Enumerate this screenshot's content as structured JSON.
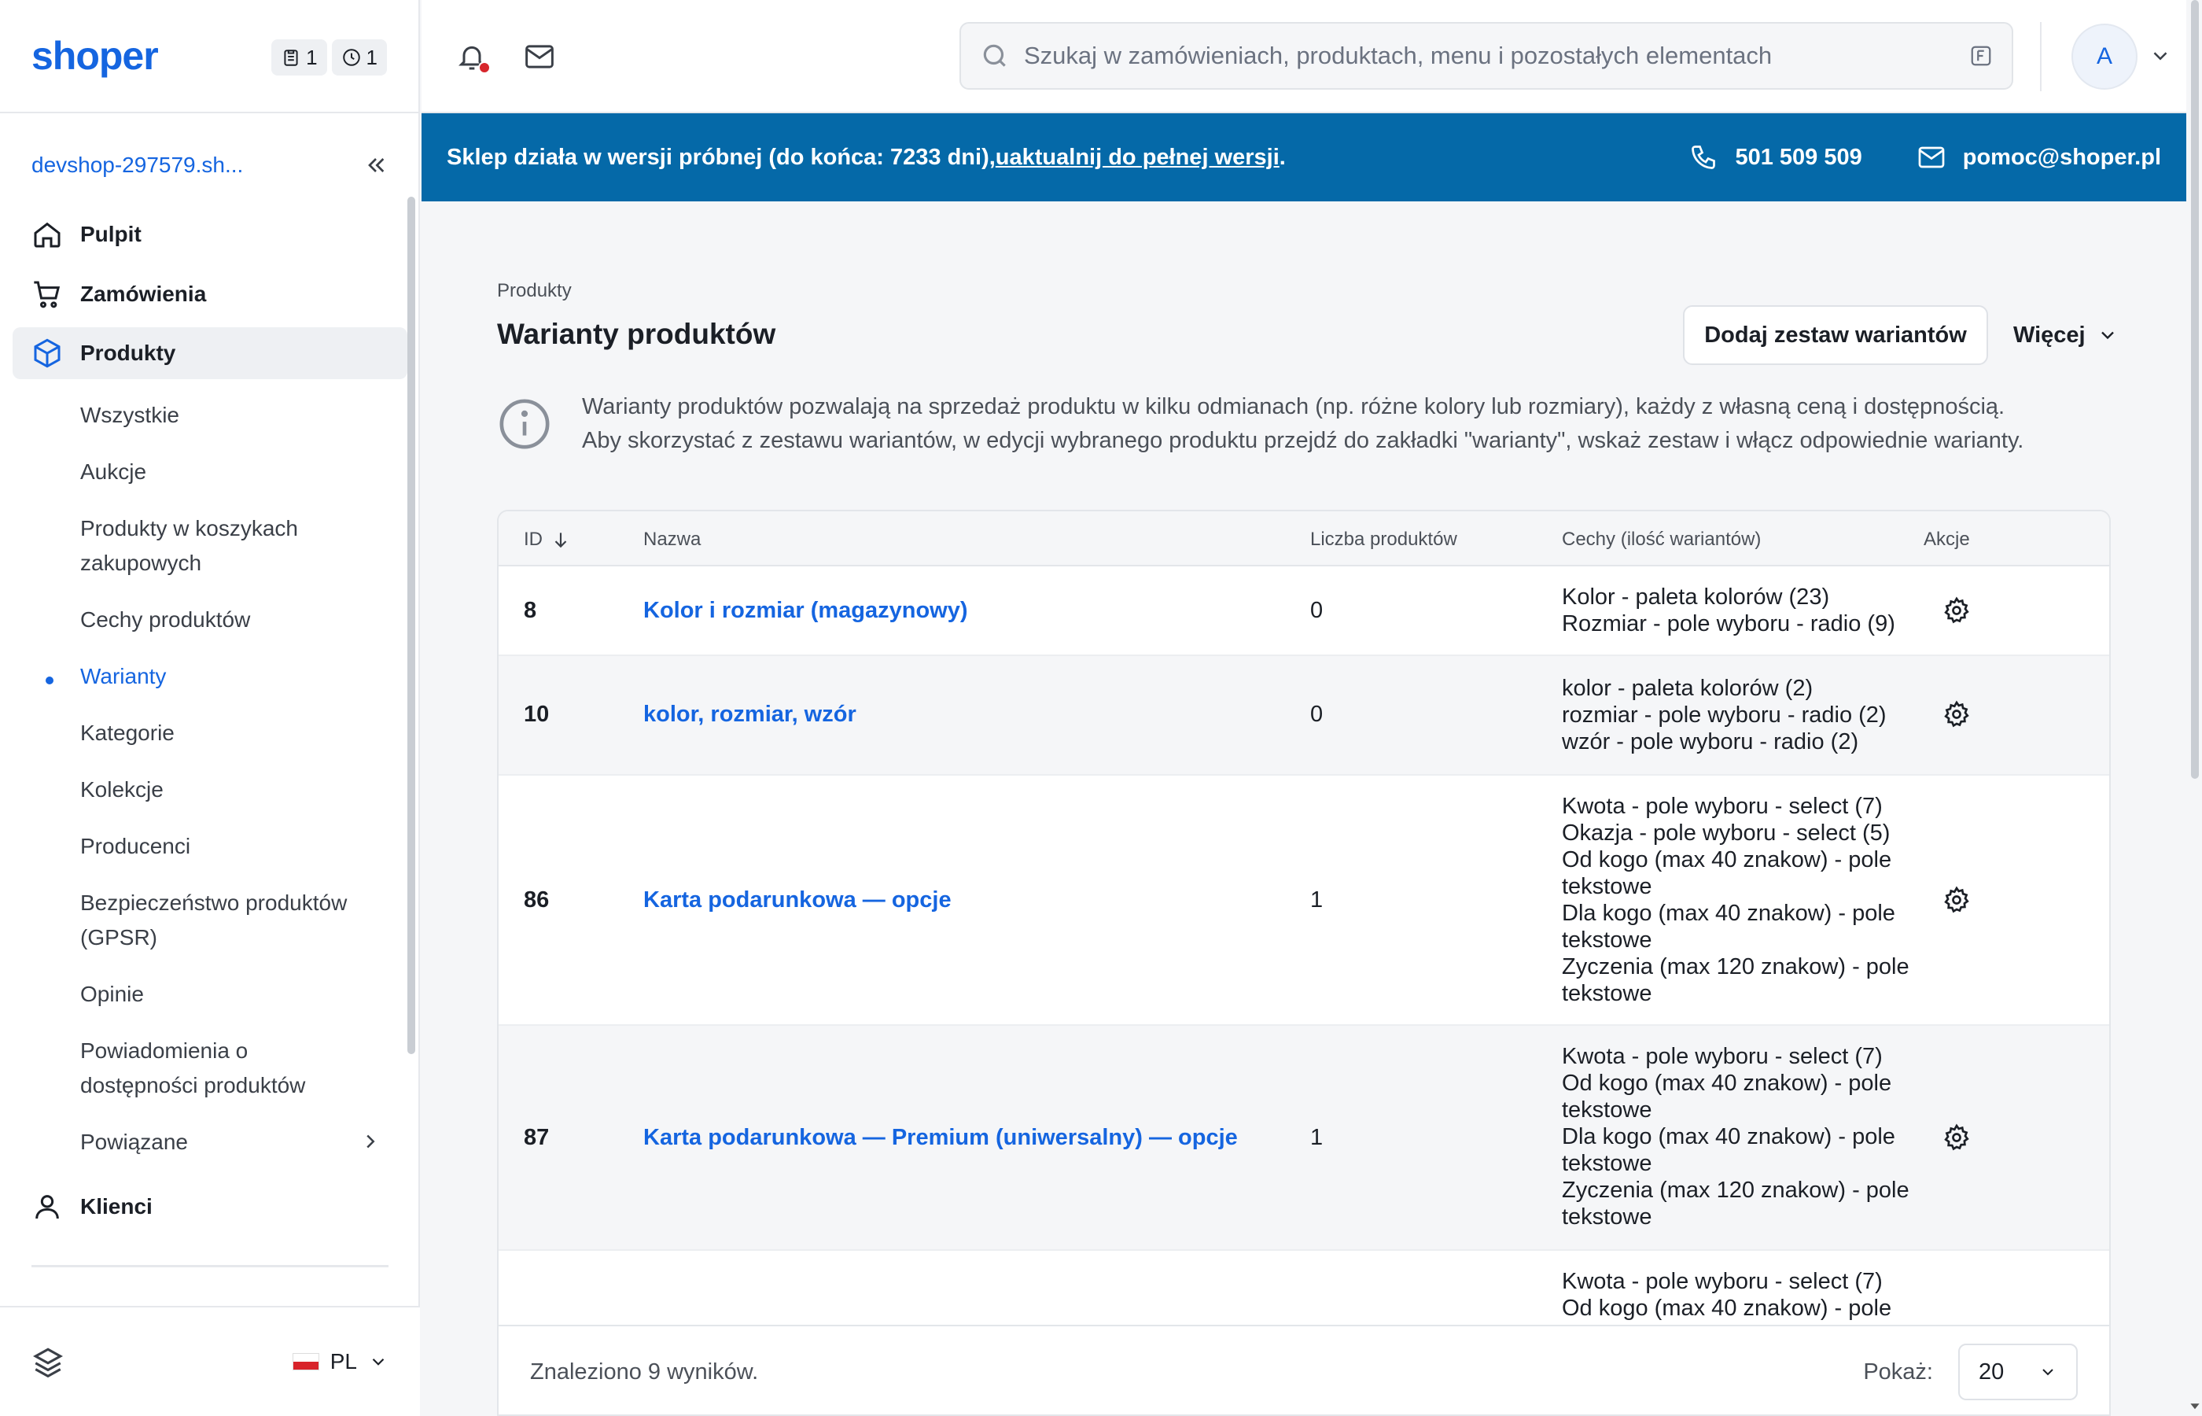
{
  "sidebar": {
    "logo": "shoper",
    "counters": [
      {
        "icon": "clipboard-icon",
        "value": "1"
      },
      {
        "icon": "clock-icon",
        "value": "1"
      }
    ],
    "shop_name": "devshop-297579.sh...",
    "nav": {
      "dashboard": "Pulpit",
      "orders": "Zamówienia",
      "products": "Produkty",
      "customers": "Klienci"
    },
    "products_sub": [
      {
        "label": "Wszystkie"
      },
      {
        "label": "Aukcje"
      },
      {
        "label": "Produkty w koszykach zakupowych"
      },
      {
        "label": "Cechy produktów"
      },
      {
        "label": "Warianty",
        "active": true
      },
      {
        "label": "Kategorie"
      },
      {
        "label": "Kolekcje"
      },
      {
        "label": "Producenci"
      },
      {
        "label": "Bezpieczeństwo produktów (GPSR)"
      },
      {
        "label": "Opinie"
      },
      {
        "label": "Powiadomienia o dostępności produktów"
      },
      {
        "label": "Powiązane",
        "has_children": true
      }
    ],
    "language": "PL"
  },
  "topbar": {
    "search_placeholder": "Szukaj w zamówieniach, produktach, menu i pozostałych elementach",
    "avatar_initial": "A",
    "has_notification": true
  },
  "banner": {
    "text": "Sklep działa w wersji próbnej (do końca: 7233 dni), ",
    "link": "uaktualnij do pełnej wersji",
    "suffix": ".",
    "phone": "501 509 509",
    "email": "pomoc@shoper.pl",
    "color": "#0569a8"
  },
  "page": {
    "breadcrumb": "Produkty",
    "title": "Warianty produktów",
    "add_button": "Dodaj zestaw wariantów",
    "more_button": "Więcej",
    "info_line1": "Warianty produktów pozwalają na sprzedaż produktu w kilku odmianach (np. różne kolory lub rozmiary), każdy z własną ceną i dostępnością.",
    "info_line2": "Aby skorzystać z zestawu wariantów, w edycji wybranego produktu przejdź do zakładki \"warianty\", wskaż zestaw i włącz odpowiednie warianty."
  },
  "table": {
    "columns": {
      "id": "ID",
      "name": "Nazwa",
      "count": "Liczba produktów",
      "features": "Cechy (ilość wariantów)",
      "actions": "Akcje"
    },
    "rows": [
      {
        "id": "8",
        "name": "Kolor i rozmiar (magazynowy)",
        "count": "0",
        "features": "Kolor - paleta kolorów (23)\nRozmiar - pole wyboru - radio (9)"
      },
      {
        "id": "10",
        "name": "kolor, rozmiar, wzór",
        "count": "0",
        "features": "kolor - paleta kolorów (2)\nrozmiar - pole wyboru - radio (2)\nwzór - pole wyboru - radio (2)"
      },
      {
        "id": "86",
        "name": "Karta podarunkowa — opcje",
        "count": "1",
        "features": "Kwota - pole wyboru - select (7)\nOkazja - pole wyboru - select (5)\nOd kogo (max 40 znakow) - pole tekstowe\nDla kogo (max 40 znakow) - pole tekstowe\nZyczenia (max 120 znakow) - pole tekstowe"
      },
      {
        "id": "87",
        "name": "Karta podarunkowa — Premium (uniwersalny) — opcje",
        "count": "1",
        "features": "Kwota - pole wyboru - select (7)\nOd kogo (max 40 znakow) - pole tekstowe\nDla kogo (max 40 znakow) - pole tekstowe\nZyczenia (max 120 znakow) - pole tekstowe"
      },
      {
        "id": "",
        "name": "",
        "count": "",
        "features": "Kwota - pole wyboru - select (7)\nOd kogo (max 40 znakow) - pole"
      }
    ],
    "found": "Znaleziono 9 wyników.",
    "show_label": "Pokaż:",
    "per_page": "20"
  }
}
